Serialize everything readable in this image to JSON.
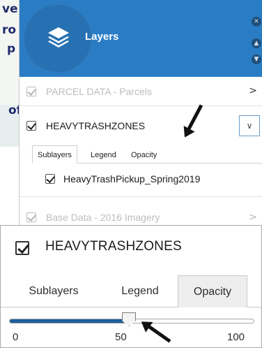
{
  "background": {
    "lines": [
      "ve",
      "ro",
      "p",
      "of"
    ]
  },
  "panel": {
    "title": "Layers",
    "header_buttons": [
      "close-icon",
      "collapse-up-icon",
      "expand-down-icon"
    ],
    "layers": [
      {
        "label": "PARCEL DATA - Parcels",
        "checked": true,
        "faded": true,
        "expanded": false
      },
      {
        "label": "HEAVYTRASHZONES",
        "checked": true,
        "faded": false,
        "expanded": true
      },
      {
        "label": "Base Data - 2016 Imagery",
        "checked": true,
        "faded": true,
        "expanded": false
      }
    ],
    "tabs": [
      "Sublayers",
      "Legend",
      "Opacity"
    ],
    "active_tab": "Sublayers",
    "sublayer": {
      "label": "HeavyTrashPickup_Spring2019",
      "checked": true
    }
  },
  "zoom": {
    "layer_label": "HEAVYTRASHZONES",
    "tabs": [
      "Sublayers",
      "Legend",
      "Opacity"
    ],
    "active_tab": "Opacity",
    "slider": {
      "min_label": "0",
      "mid_label": "50",
      "max_label": "100",
      "value": 50,
      "min": 0,
      "max": 100
    }
  },
  "colors": {
    "header": "#2a7dc4",
    "slider_fill": "#1e5e9c",
    "text": "#1b1b1b"
  }
}
